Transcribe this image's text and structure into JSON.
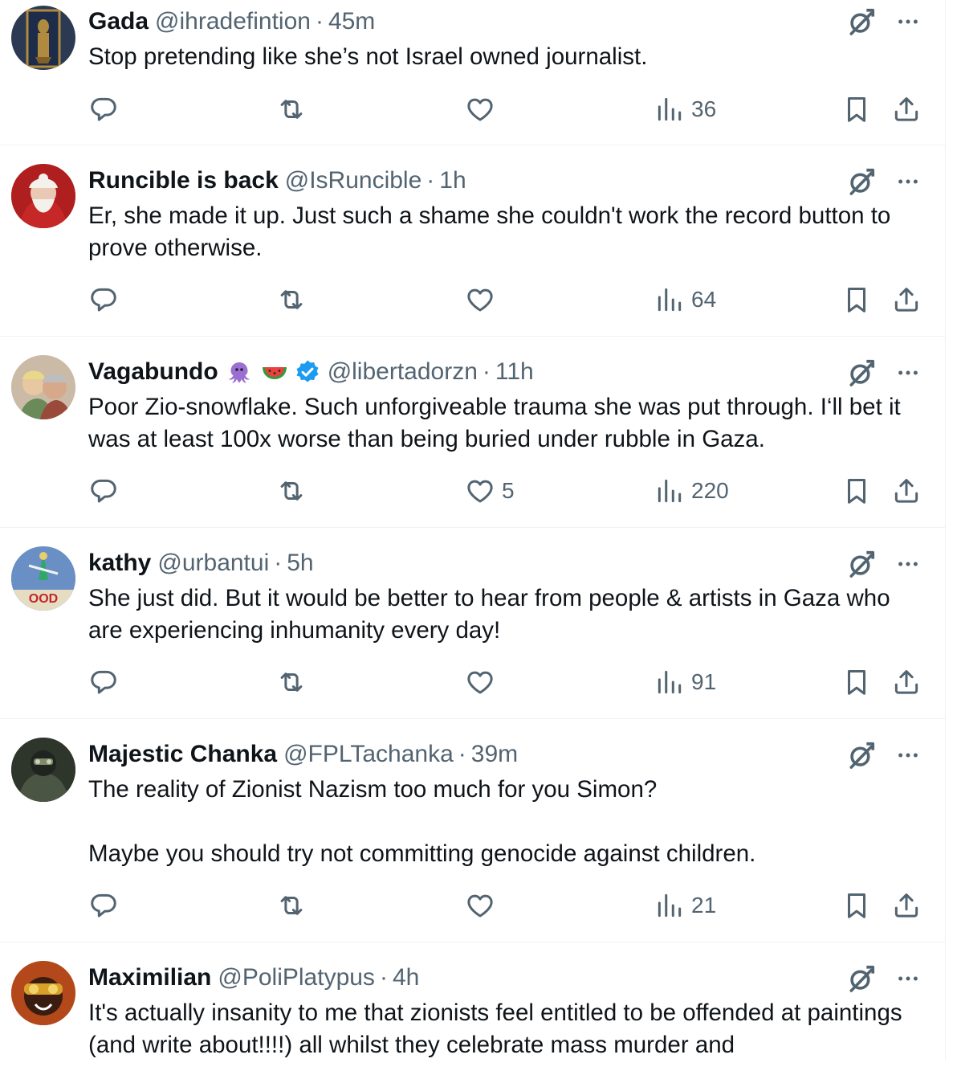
{
  "tweets": [
    {
      "name": "Gada",
      "handle": "@ihradefintion",
      "separator": "·",
      "time": "45m",
      "text": "Stop pretending like she’s not Israel owned journalist.",
      "reply_count": "",
      "retweet_count": "",
      "like_count": "",
      "views": "36",
      "avatar_colors": [
        "#2b3a52",
        "#b08a3e"
      ]
    },
    {
      "name": "Runcible is back",
      "handle": "@IsRuncible",
      "separator": "·",
      "time": "1h",
      "text": "Er, she made it up. Just such a shame she couldn't work the record button to prove otherwise.",
      "reply_count": "",
      "retweet_count": "",
      "like_count": "",
      "views": "64",
      "avatar_colors": [
        "#a21c1c",
        "#f2ede6"
      ]
    },
    {
      "name": "Vagabundo",
      "handle": "@libertadorzn",
      "separator": "·",
      "time": "11h",
      "text": "Poor Zio-snowflake.  Such unforgiveable trauma she was put through.  I‘ll bet it was at least 100x worse than being buried under rubble in Gaza.",
      "reply_count": "",
      "retweet_count": "",
      "like_count": "5",
      "views": "220",
      "avatar_colors": [
        "#d8c8b4",
        "#7d6750"
      ],
      "verified": true
    },
    {
      "name": "kathy",
      "handle": "@urbantui",
      "separator": "·",
      "time": "5h",
      "text": "She just did. But it would be better to hear from people & artists in Gaza who are experiencing inhumanity every day!",
      "reply_count": "",
      "retweet_count": "",
      "like_count": "",
      "views": "91",
      "avatar_colors": [
        "#5b7fb0",
        "#e8e0c8"
      ],
      "avatar_text": "OOD"
    },
    {
      "name": "Majestic Chanka",
      "handle": "@FPLTachanka",
      "separator": "·",
      "time": "39m",
      "text": "The reality of Zionist Nazism too much for you Simon?\n\nMaybe you should try not committing genocide against children.",
      "reply_count": "",
      "retweet_count": "",
      "like_count": "",
      "views": "21",
      "avatar_colors": [
        "#3d4638",
        "#8b8f7a"
      ]
    },
    {
      "name": "Maximilian",
      "handle": "@PoliPlatypus",
      "separator": "·",
      "time": "4h",
      "text": "It's actually insanity to me that zionists feel entitled to be offended at paintings (and write about!!!!) all whilst they celebrate mass murder and",
      "reply_count": "",
      "retweet_count": "",
      "like_count": "",
      "views": "",
      "avatar_colors": [
        "#c4561a",
        "#2a1a10"
      ]
    }
  ],
  "colors": {
    "text": "#0f1419",
    "secondary": "#536471",
    "divider": "#eff3f4",
    "verified": "#1d9bf0",
    "emoji_octopus": "#9b6fd1",
    "emoji_watermelon_rind": "#2e9d3a",
    "emoji_watermelon_flesh": "#e8413e"
  },
  "icons": {
    "top": [
      "grok-slash-icon",
      "more-icon"
    ],
    "actions": [
      "reply-icon",
      "retweet-icon",
      "like-icon",
      "views-icon",
      "bookmark-icon",
      "share-icon"
    ],
    "emoji": [
      "octopus-emoji",
      "watermelon-emoji"
    ]
  }
}
